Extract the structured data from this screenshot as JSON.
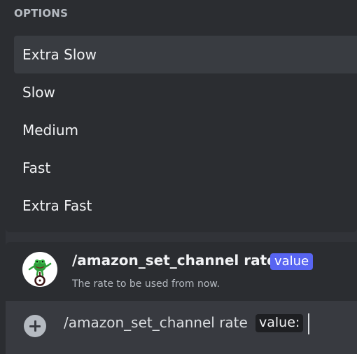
{
  "options": {
    "header": "OPTIONS",
    "items": [
      {
        "label": "Extra Slow",
        "selected": true
      },
      {
        "label": "Slow",
        "selected": false
      },
      {
        "label": "Medium",
        "selected": false
      },
      {
        "label": "Fast",
        "selected": false
      },
      {
        "label": "Extra Fast",
        "selected": false
      }
    ]
  },
  "command": {
    "name": "/amazon_set_channel rate",
    "parameter": "value",
    "description": "The rate to be used from now.",
    "avatar_icon": "frog-on-unicycle-avatar"
  },
  "input": {
    "text": "/amazon_set_channel rate",
    "chip": "value:",
    "plus_icon": "plus-circle-icon"
  },
  "colors": {
    "accent": "#5865f2",
    "panel": "#2b2d31",
    "background": "#313338",
    "input": "#383a40"
  }
}
